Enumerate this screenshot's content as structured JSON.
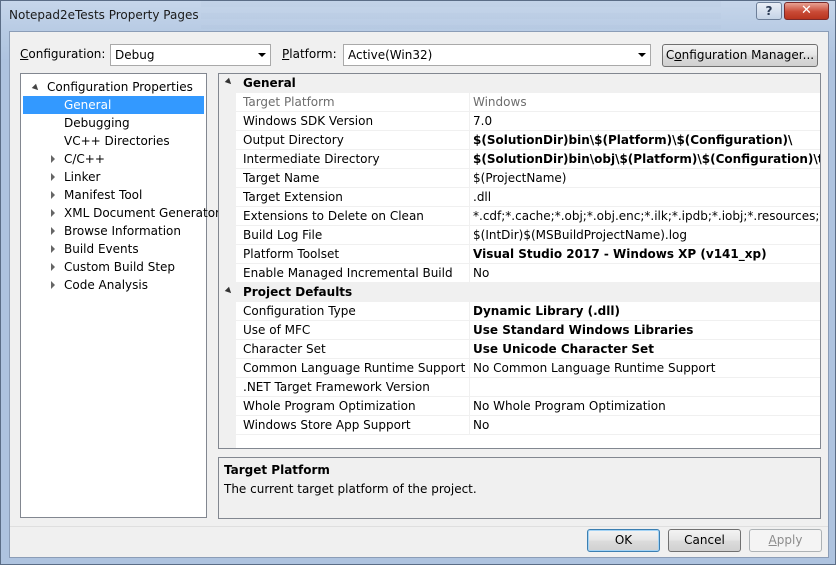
{
  "window": {
    "title": "Notepad2eTests Property Pages",
    "help_label": "?",
    "close_label": "✕"
  },
  "toolbar": {
    "configuration_label_pre": "C",
    "configuration_label_rest": "onfiguration:",
    "configuration_value": "Debug",
    "platform_label_pre": "P",
    "platform_label_rest": "latform:",
    "platform_value": "Active(Win32)",
    "config_manager_pre": "C",
    "config_manager_u": "o",
    "config_manager_rest": "nfiguration Manager..."
  },
  "tree": {
    "root": "Configuration Properties",
    "items": [
      {
        "label": "General",
        "selected": true,
        "expander": "none"
      },
      {
        "label": "Debugging",
        "selected": false,
        "expander": "none"
      },
      {
        "label": "VC++ Directories",
        "selected": false,
        "expander": "none"
      },
      {
        "label": "C/C++",
        "selected": false,
        "expander": "closed"
      },
      {
        "label": "Linker",
        "selected": false,
        "expander": "closed"
      },
      {
        "label": "Manifest Tool",
        "selected": false,
        "expander": "closed"
      },
      {
        "label": "XML Document Generator",
        "selected": false,
        "expander": "closed"
      },
      {
        "label": "Browse Information",
        "selected": false,
        "expander": "closed"
      },
      {
        "label": "Build Events",
        "selected": false,
        "expander": "closed"
      },
      {
        "label": "Custom Build Step",
        "selected": false,
        "expander": "closed"
      },
      {
        "label": "Code Analysis",
        "selected": false,
        "expander": "closed"
      }
    ]
  },
  "grid": {
    "categories": [
      {
        "name": "General",
        "rows": [
          {
            "name": "Target Platform",
            "value": "Windows",
            "bold": false,
            "dim": true
          },
          {
            "name": "Windows SDK Version",
            "value": "7.0",
            "bold": false,
            "dim": false
          },
          {
            "name": "Output Directory",
            "value": "$(SolutionDir)bin\\$(Platform)\\$(Configuration)\\",
            "bold": true,
            "dim": false
          },
          {
            "name": "Intermediate Directory",
            "value": "$(SolutionDir)bin\\obj\\$(Platform)\\$(Configuration)\\test\\",
            "bold": true,
            "dim": false
          },
          {
            "name": "Target Name",
            "value": "$(ProjectName)",
            "bold": false,
            "dim": false
          },
          {
            "name": "Target Extension",
            "value": ".dll",
            "bold": false,
            "dim": false
          },
          {
            "name": "Extensions to Delete on Clean",
            "value": "*.cdf;*.cache;*.obj;*.obj.enc;*.ilk;*.ipdb;*.iobj;*.resources;*.tlb;*.tli;*.t",
            "bold": false,
            "dim": false
          },
          {
            "name": "Build Log File",
            "value": "$(IntDir)$(MSBuildProjectName).log",
            "bold": false,
            "dim": false
          },
          {
            "name": "Platform Toolset",
            "value": "Visual Studio 2017 - Windows XP (v141_xp)",
            "bold": true,
            "dim": false
          },
          {
            "name": "Enable Managed Incremental Build",
            "value": "No",
            "bold": false,
            "dim": false
          }
        ]
      },
      {
        "name": "Project Defaults",
        "rows": [
          {
            "name": "Configuration Type",
            "value": "Dynamic Library (.dll)",
            "bold": true,
            "dim": false
          },
          {
            "name": "Use of MFC",
            "value": "Use Standard Windows Libraries",
            "bold": true,
            "dim": false
          },
          {
            "name": "Character Set",
            "value": "Use Unicode Character Set",
            "bold": true,
            "dim": false
          },
          {
            "name": "Common Language Runtime Support",
            "value": "No Common Language Runtime Support",
            "bold": false,
            "dim": false
          },
          {
            "name": ".NET Target Framework Version",
            "value": "",
            "bold": false,
            "dim": false
          },
          {
            "name": "Whole Program Optimization",
            "value": "No Whole Program Optimization",
            "bold": false,
            "dim": false
          },
          {
            "name": "Windows Store App Support",
            "value": "No",
            "bold": false,
            "dim": false
          }
        ]
      }
    ]
  },
  "description": {
    "title": "Target Platform",
    "text": "The current target platform of the project."
  },
  "buttons": {
    "ok": "OK",
    "cancel": "Cancel",
    "apply_pre": "A",
    "apply_rest": "pply"
  }
}
